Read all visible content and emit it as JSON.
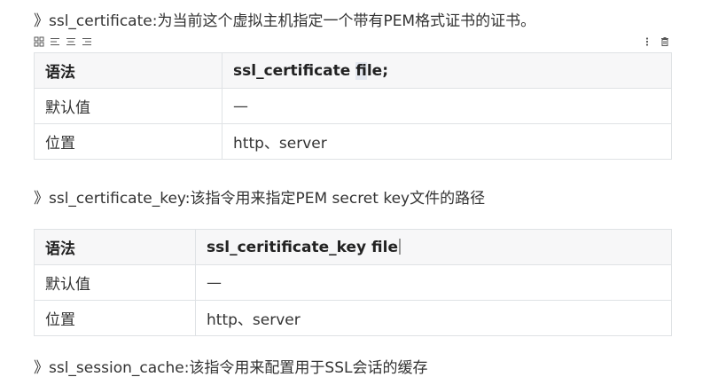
{
  "heading1": "》ssl_certificate:为当前这个虚拟主机指定一个带有PEM格式证书的证书。",
  "table1": {
    "rows": [
      {
        "label": "语法",
        "value_pre": "ssl_certificate ",
        "value_hl": "fi",
        "value_post": "le;"
      },
      {
        "label": "默认值",
        "value": "—"
      },
      {
        "label": "位置",
        "value": "http、server"
      }
    ]
  },
  "heading2": "》ssl_certificate_key:该指令用来指定PEM secret key文件的路径",
  "table2": {
    "rows": [
      {
        "label": "语法",
        "value": "ssl_ceritificate_key file"
      },
      {
        "label": "默认值",
        "value": "—"
      },
      {
        "label": "位置",
        "value": "http、server"
      }
    ]
  },
  "heading3": "》ssl_session_cache:该指令用来配置用于SSL会话的缓存",
  "toolbar": {
    "left_icons": [
      "grid-icon",
      "align-left-icon",
      "align-center-icon",
      "align-right-icon"
    ],
    "right_icons": [
      "more-vertical-icon",
      "trash-icon"
    ]
  },
  "colors": {
    "border": "#dfe2e5",
    "header_bg": "#f7f7f8"
  }
}
